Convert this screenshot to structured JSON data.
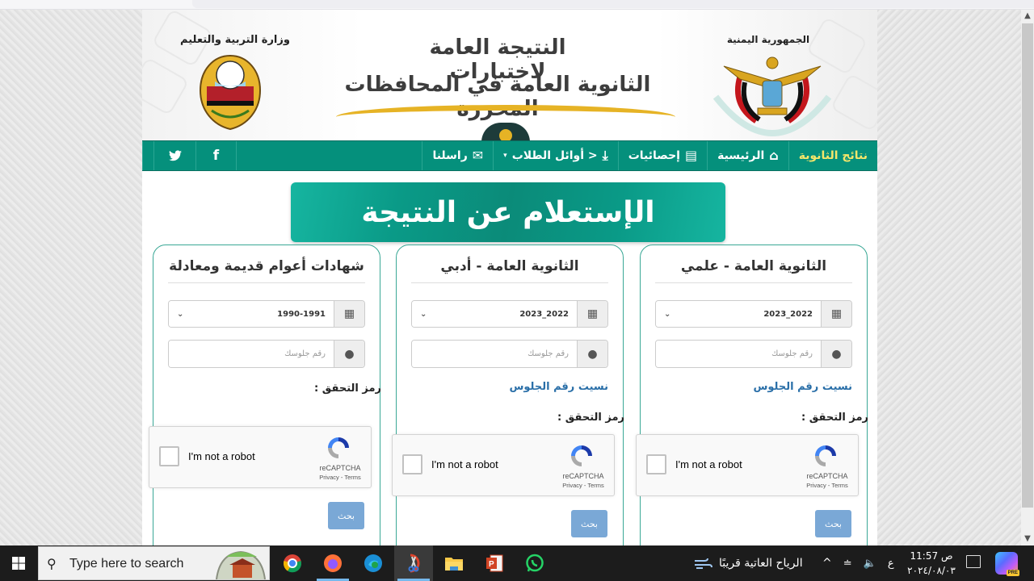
{
  "banner": {
    "title_line1": "النتيجة العامة لاختبارات",
    "title_line2": "الثانوية العامة في المحافظات المحررة",
    "ministry_label": "وزارة التربية والتعليم",
    "republic_label": "الجمهورية اليمنية"
  },
  "nav": {
    "brand": "نتائج الثانوية",
    "items": [
      {
        "label": "الرئيسية",
        "icon": "home-icon"
      },
      {
        "label": "إحصائيات",
        "icon": "list-icon"
      },
      {
        "label": "< أوائل الطلاب",
        "icon": "upload-icon",
        "dropdown": true
      },
      {
        "label": "راسلنا",
        "icon": "envelope-icon"
      }
    ],
    "social": [
      {
        "name": "facebook",
        "glyph": "f"
      },
      {
        "name": "twitter",
        "glyph": "🐦"
      }
    ]
  },
  "inquiry_title": "الإستعلام عن النتيجة",
  "cards": [
    {
      "title": "الثانوية العامة - علمي",
      "year": "2023_2022",
      "seat_placeholder": "رقم جلوسك",
      "forgot_link": "نسيت رقم الجلوس",
      "verify_label": "رمز التحقق :",
      "captcha_text": "I'm not a robot",
      "captcha_brand": "reCAPTCHA",
      "captcha_links": "Privacy - Terms",
      "search_label": "بحث"
    },
    {
      "title": "الثانوية العامة - أدبي",
      "year": "2023_2022",
      "seat_placeholder": "رقم جلوسك",
      "forgot_link": "نسيت رقم الجلوس",
      "verify_label": "رمز التحقق :",
      "captcha_text": "I'm not a robot",
      "captcha_brand": "reCAPTCHA",
      "captcha_links": "Privacy - Terms",
      "search_label": "بحث"
    },
    {
      "title": "شهادات أعوام قديمة ومعادلة",
      "year": "1990-1991",
      "seat_placeholder": "رقم جلوسك",
      "verify_label": "رمز التحقق :",
      "captcha_text": "I'm not a robot",
      "captcha_brand": "reCAPTCHA",
      "captcha_links": "Privacy - Terms",
      "search_label": "بحث"
    }
  ],
  "scrollbar": {
    "up": "^",
    "down": "v"
  },
  "taskbar": {
    "search_placeholder": "Type here to search",
    "apps": [
      "chrome",
      "firefox",
      "edge",
      "snipping-tool",
      "file-explorer",
      "powerpoint",
      "whatsapp"
    ],
    "weather": "الرياح العاتية قريبًا",
    "tray_chevron": "^",
    "language": "ع",
    "time": "ص 11:57",
    "date": "٢٠٢٤/٠٨/٠٣",
    "copilot_badge": "PRE"
  }
}
